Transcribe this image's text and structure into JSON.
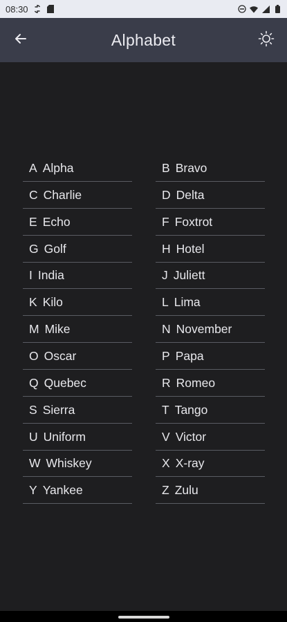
{
  "status_bar": {
    "time": "08:30",
    "icons": [
      "sync-icon",
      "sd-card-icon",
      "do-not-disturb-icon",
      "wifi-icon",
      "signal-icon",
      "battery-icon"
    ]
  },
  "app_bar": {
    "title": "Alphabet",
    "back_icon": "arrow-left-icon",
    "theme_icon": "sun-icon",
    "background": "#3a3d4a"
  },
  "colors": {
    "background": "#1e1e20",
    "text": "#e8e8ec",
    "divider": "#5a5c63"
  },
  "alphabet": [
    {
      "letter": "A",
      "word": "Alpha"
    },
    {
      "letter": "B",
      "word": "Bravo"
    },
    {
      "letter": "C",
      "word": "Charlie"
    },
    {
      "letter": "D",
      "word": "Delta"
    },
    {
      "letter": "E",
      "word": "Echo"
    },
    {
      "letter": "F",
      "word": "Foxtrot"
    },
    {
      "letter": "G",
      "word": "Golf"
    },
    {
      "letter": "H",
      "word": "Hotel"
    },
    {
      "letter": "I",
      "word": "India"
    },
    {
      "letter": "J",
      "word": "Juliett"
    },
    {
      "letter": "K",
      "word": "Kilo"
    },
    {
      "letter": "L",
      "word": "Lima"
    },
    {
      "letter": "M",
      "word": "Mike"
    },
    {
      "letter": "N",
      "word": "November"
    },
    {
      "letter": "O",
      "word": "Oscar"
    },
    {
      "letter": "P",
      "word": "Papa"
    },
    {
      "letter": "Q",
      "word": "Quebec"
    },
    {
      "letter": "R",
      "word": "Romeo"
    },
    {
      "letter": "S",
      "word": "Sierra"
    },
    {
      "letter": "T",
      "word": "Tango"
    },
    {
      "letter": "U",
      "word": "Uniform"
    },
    {
      "letter": "V",
      "word": "Victor"
    },
    {
      "letter": "W",
      "word": "Whiskey"
    },
    {
      "letter": "X",
      "word": "X-ray"
    },
    {
      "letter": "Y",
      "word": "Yankee"
    },
    {
      "letter": "Z",
      "word": "Zulu"
    }
  ]
}
